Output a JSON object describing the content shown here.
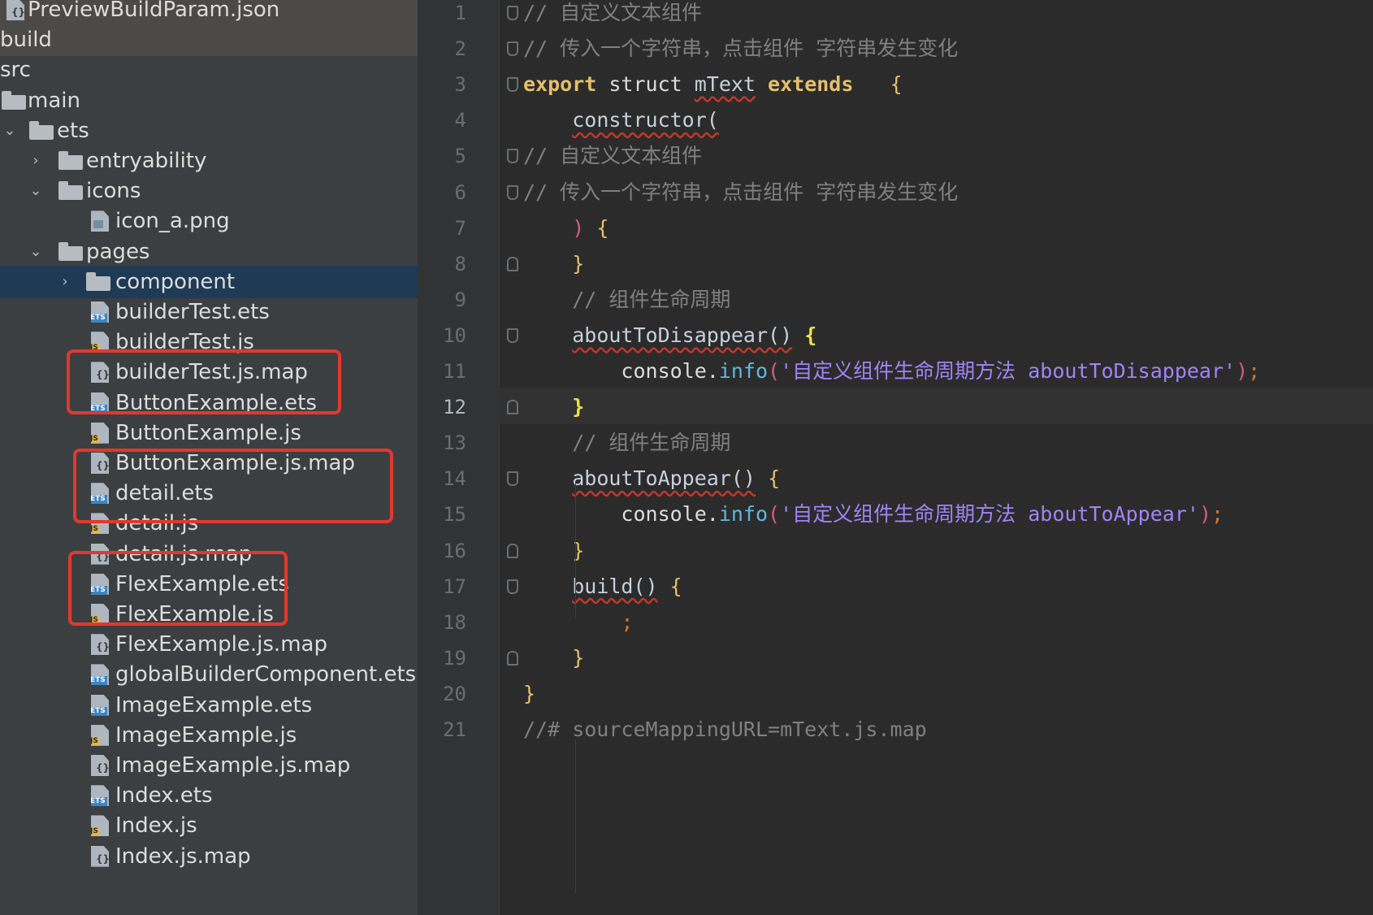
{
  "tree": {
    "items": [
      {
        "label": "PreviewBuildParam.json",
        "icon": "json-file-icon",
        "depth": 0,
        "chevron": "",
        "kind": "file"
      },
      {
        "label": "build",
        "icon": "",
        "depth": 0,
        "chevron": "",
        "kind": "text"
      },
      {
        "label": "src",
        "icon": "",
        "depth": 0,
        "chevron": "",
        "kind": "text"
      },
      {
        "label": "main",
        "icon": "folder-icon",
        "depth": 0,
        "chevron": "",
        "kind": "folder"
      },
      {
        "label": "ets",
        "icon": "folder-icon",
        "depth": 1,
        "chevron": "⌄",
        "kind": "folder"
      },
      {
        "label": "entryability",
        "icon": "folder-icon",
        "depth": 2,
        "chevron": "›",
        "kind": "folder"
      },
      {
        "label": "icons",
        "icon": "folder-icon",
        "depth": 2,
        "chevron": "⌄",
        "kind": "folder"
      },
      {
        "label": "icon_a.png",
        "icon": "png-file-icon",
        "depth": 3,
        "chevron": "",
        "kind": "png"
      },
      {
        "label": "pages",
        "icon": "folder-icon",
        "depth": 2,
        "chevron": "⌄",
        "kind": "folder"
      },
      {
        "label": "component",
        "icon": "folder-icon",
        "depth": 3,
        "chevron": "›",
        "kind": "folder"
      },
      {
        "label": "builderTest.ets",
        "icon": "ets-file-icon",
        "depth": 3,
        "chevron": "",
        "kind": "ets"
      },
      {
        "label": "builderTest.js",
        "icon": "js-file-icon",
        "depth": 3,
        "chevron": "",
        "kind": "js"
      },
      {
        "label": "builderTest.js.map",
        "icon": "map-file-icon",
        "depth": 3,
        "chevron": "",
        "kind": "map"
      },
      {
        "label": "ButtonExample.ets",
        "icon": "ets-file-icon",
        "depth": 3,
        "chevron": "",
        "kind": "ets"
      },
      {
        "label": "ButtonExample.js",
        "icon": "js-file-icon",
        "depth": 3,
        "chevron": "",
        "kind": "js"
      },
      {
        "label": "ButtonExample.js.map",
        "icon": "map-file-icon",
        "depth": 3,
        "chevron": "",
        "kind": "map"
      },
      {
        "label": "detail.ets",
        "icon": "ets-file-icon",
        "depth": 3,
        "chevron": "",
        "kind": "ets"
      },
      {
        "label": "detail.js",
        "icon": "js-file-icon",
        "depth": 3,
        "chevron": "",
        "kind": "js"
      },
      {
        "label": "detail.js.map",
        "icon": "map-file-icon",
        "depth": 3,
        "chevron": "",
        "kind": "map"
      },
      {
        "label": "FlexExample.ets",
        "icon": "ets-file-icon",
        "depth": 3,
        "chevron": "",
        "kind": "ets"
      },
      {
        "label": "FlexExample.js",
        "icon": "js-file-icon",
        "depth": 3,
        "chevron": "",
        "kind": "js"
      },
      {
        "label": "FlexExample.js.map",
        "icon": "map-file-icon",
        "depth": 3,
        "chevron": "",
        "kind": "map"
      },
      {
        "label": "globalBuilderComponent.ets",
        "icon": "ets-file-icon",
        "depth": 3,
        "chevron": "",
        "kind": "ets"
      },
      {
        "label": "ImageExample.ets",
        "icon": "ets-file-icon",
        "depth": 3,
        "chevron": "",
        "kind": "ets"
      },
      {
        "label": "ImageExample.js",
        "icon": "js-file-icon",
        "depth": 3,
        "chevron": "",
        "kind": "js"
      },
      {
        "label": "ImageExample.js.map",
        "icon": "map-file-icon",
        "depth": 3,
        "chevron": "",
        "kind": "map"
      },
      {
        "label": "Index.ets",
        "icon": "ets-file-icon",
        "depth": 3,
        "chevron": "",
        "kind": "ets"
      },
      {
        "label": "Index.js",
        "icon": "js-file-icon",
        "depth": 3,
        "chevron": "",
        "kind": "js"
      },
      {
        "label": "Index.js.map",
        "icon": "map-file-icon",
        "depth": 3,
        "chevron": "",
        "kind": "map"
      }
    ],
    "selected_label": "component",
    "tags": {
      "ets": "ETS",
      "js": "JS",
      "map": "{}"
    }
  },
  "editor": {
    "current_line": "12",
    "lines": [
      {
        "no": "1",
        "t": [
          [
            "cm",
            "// 自定义文本组件"
          ]
        ]
      },
      {
        "no": "2",
        "t": [
          [
            "cm",
            "// 传入一个字符串，点击组件 字符串发生变化"
          ]
        ]
      },
      {
        "no": "3",
        "t": [
          [
            "kw",
            "export "
          ],
          [
            "id",
            "struct "
          ],
          [
            "fn",
            "mText"
          ],
          [
            "id",
            " "
          ],
          [
            "kw",
            "extends"
          ],
          [
            "id",
            "   "
          ],
          [
            "brace",
            "{"
          ]
        ]
      },
      {
        "no": "4",
        "t": [
          [
            "id",
            "    "
          ],
          [
            "fn",
            "constructor("
          ]
        ]
      },
      {
        "no": "5",
        "t": [
          [
            "cm",
            "// 自定义文本组件"
          ]
        ]
      },
      {
        "no": "6",
        "t": [
          [
            "cm",
            "// 传入一个字符串，点击组件 字符串发生变化"
          ]
        ]
      },
      {
        "no": "7",
        "t": [
          [
            "id",
            "    "
          ],
          [
            "paren",
            ")"
          ],
          [
            "id",
            " "
          ],
          [
            "brace",
            "{"
          ]
        ]
      },
      {
        "no": "8",
        "t": [
          [
            "id",
            "    "
          ],
          [
            "brace",
            "}"
          ]
        ]
      },
      {
        "no": "9",
        "t": [
          [
            "id",
            "    "
          ],
          [
            "cm",
            "// 组件生命周期"
          ]
        ]
      },
      {
        "no": "10",
        "t": [
          [
            "id",
            "    "
          ],
          [
            "fn",
            "aboutToDisappear()"
          ],
          [
            "id",
            " "
          ],
          [
            "brace2",
            "{"
          ]
        ]
      },
      {
        "no": "11",
        "t": [
          [
            "id",
            "        console."
          ],
          [
            "mth",
            "info"
          ],
          [
            "paren",
            "("
          ],
          [
            "str",
            "'自定义组件生命周期方法 aboutToDisappear'"
          ],
          [
            "paren",
            ")"
          ],
          [
            "pun",
            ";"
          ]
        ]
      },
      {
        "no": "12",
        "t": [
          [
            "id",
            "    "
          ],
          [
            "brace2",
            "}"
          ]
        ]
      },
      {
        "no": "13",
        "t": [
          [
            "id",
            "    "
          ],
          [
            "cm",
            "// 组件生命周期"
          ]
        ]
      },
      {
        "no": "14",
        "t": [
          [
            "id",
            "    "
          ],
          [
            "fn",
            "aboutToAppear()"
          ],
          [
            "id",
            " "
          ],
          [
            "brace",
            "{"
          ]
        ]
      },
      {
        "no": "15",
        "t": [
          [
            "id",
            "        console."
          ],
          [
            "mth",
            "info"
          ],
          [
            "paren",
            "("
          ],
          [
            "str",
            "'自定义组件生命周期方法 aboutToAppear'"
          ],
          [
            "paren",
            ")"
          ],
          [
            "pun",
            ";"
          ]
        ]
      },
      {
        "no": "16",
        "t": [
          [
            "id",
            "    "
          ],
          [
            "brace",
            "}"
          ]
        ]
      },
      {
        "no": "17",
        "t": [
          [
            "id",
            "    "
          ],
          [
            "fn",
            "build()"
          ],
          [
            "id",
            " "
          ],
          [
            "brace",
            "{"
          ]
        ]
      },
      {
        "no": "18",
        "t": [
          [
            "id",
            "        "
          ],
          [
            "pun",
            ";"
          ]
        ]
      },
      {
        "no": "19",
        "t": [
          [
            "id",
            "    "
          ],
          [
            "brace",
            "}"
          ]
        ]
      },
      {
        "no": "20",
        "t": [
          [
            "brace",
            "}"
          ]
        ]
      },
      {
        "no": "21",
        "t": [
          [
            "cm",
            "//# sourceMappingURL=mText.js.map"
          ]
        ]
      }
    ]
  },
  "annotations": {
    "highlight_groups": [
      [
        "builderTest.js",
        "builderTest.js.map"
      ],
      [
        "ButtonExample.js",
        "ButtonExample.js.map"
      ],
      [
        "detail.js",
        "detail.js.map"
      ]
    ],
    "box_color": "#e2382d"
  }
}
